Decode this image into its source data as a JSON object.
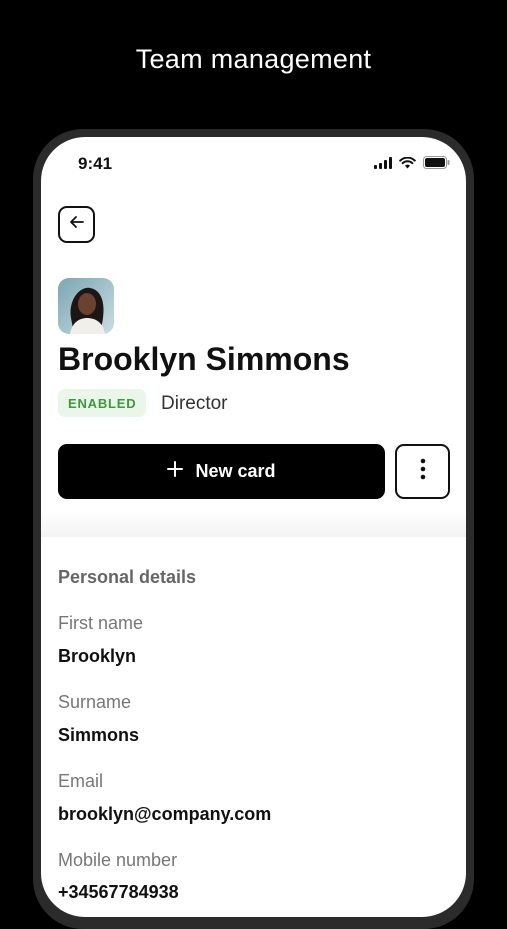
{
  "page": {
    "headline": "Team management"
  },
  "status_bar": {
    "time": "9:41"
  },
  "profile": {
    "name": "Brooklyn Simmons",
    "status": "ENABLED",
    "role": "Director"
  },
  "actions": {
    "new_card_label": "New card"
  },
  "personal_details": {
    "title": "Personal details",
    "fields": [
      {
        "label": "First name",
        "value": "Brooklyn"
      },
      {
        "label": "Surname",
        "value": "Simmons"
      },
      {
        "label": "Email",
        "value": "brooklyn@company.com"
      },
      {
        "label": "Mobile number",
        "value": "+34567784938"
      }
    ]
  },
  "colors": {
    "badge_bg": "#eaf6ea",
    "badge_text": "#3a9b3a",
    "primary": "#000000"
  },
  "icons": [
    "back-arrow-icon",
    "plus-icon",
    "more-vertical-icon",
    "cellular-signal-icon",
    "wifi-icon",
    "battery-icon"
  ]
}
